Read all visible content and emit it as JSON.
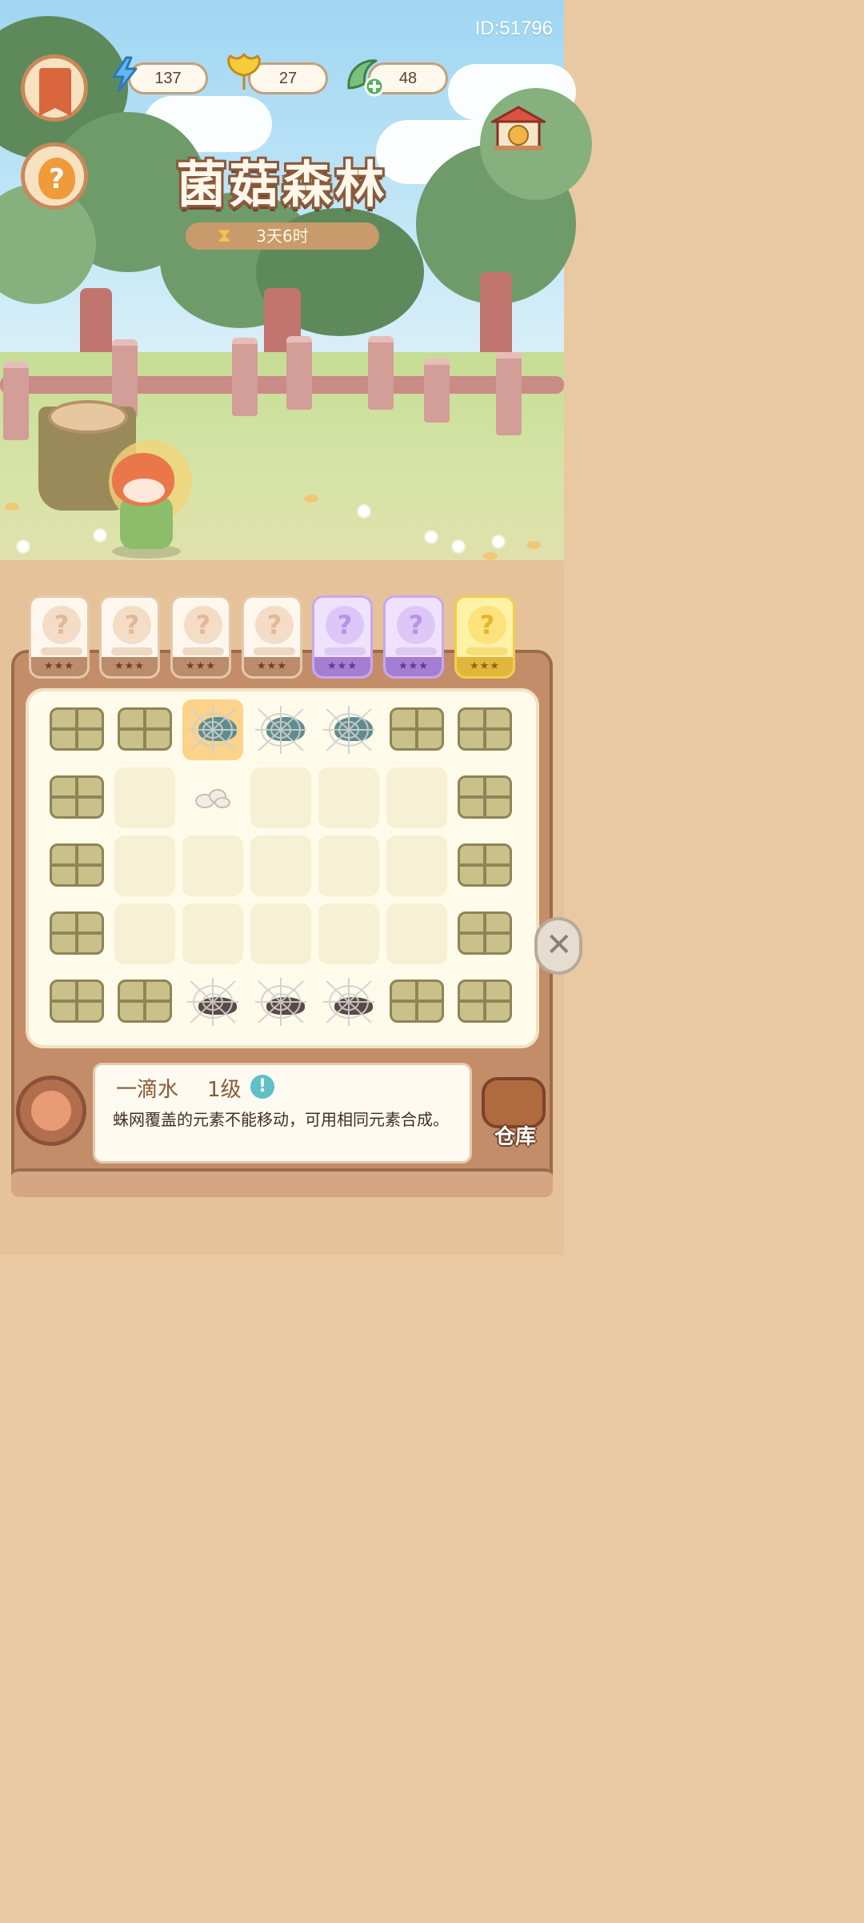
{
  "header": {
    "player_id": "ID:51796",
    "resources": [
      {
        "name": "energy",
        "icon": "lightning-icon",
        "value": "137"
      },
      {
        "name": "ginkgo",
        "icon": "ginkgo-leaf-icon",
        "value": "27"
      },
      {
        "name": "leaf",
        "icon": "leaf-plus-icon",
        "value": "48"
      }
    ]
  },
  "event": {
    "title": "菌菇森林",
    "timer": "3天6时"
  },
  "slots": [
    {
      "tier": "common",
      "symbol": "?",
      "stars": "★★★"
    },
    {
      "tier": "common",
      "symbol": "?",
      "stars": "★★★"
    },
    {
      "tier": "common",
      "symbol": "?",
      "stars": "★★★"
    },
    {
      "tier": "common",
      "symbol": "?",
      "stars": "★★★"
    },
    {
      "tier": "rare",
      "symbol": "?",
      "stars": "★★★"
    },
    {
      "tier": "rare",
      "symbol": "?",
      "stars": "★★★"
    },
    {
      "tier": "epic",
      "symbol": "?",
      "stars": "★★★"
    }
  ],
  "board": {
    "rows": [
      [
        "hay",
        "hay",
        "web-teal-stone-selected",
        "web-teal-stone",
        "web-teal-stone",
        "hay",
        "hay"
      ],
      [
        "hay",
        "empty",
        "pebbles",
        "empty",
        "empty",
        "empty",
        "hay"
      ],
      [
        "hay",
        "empty",
        "empty",
        "empty",
        "empty",
        "empty",
        "hay"
      ],
      [
        "hay",
        "empty",
        "empty",
        "empty",
        "empty",
        "empty",
        "hay"
      ],
      [
        "hay",
        "hay",
        "web-brown-stone",
        "web-brown-stone",
        "web-brown-stone",
        "hay",
        "hay"
      ]
    ]
  },
  "info": {
    "item_name": "一滴水",
    "item_level": "1级",
    "badge": "!",
    "description": "蛛网覆盖的元素不能移动，可用相同元素合成。"
  },
  "warehouse": {
    "label": "仓库"
  },
  "colors": {
    "hay": "#c9c08a",
    "accent_brown": "#8a5a36",
    "rare_purple": "#a57ed4",
    "epic_gold": "#e2b63a"
  }
}
